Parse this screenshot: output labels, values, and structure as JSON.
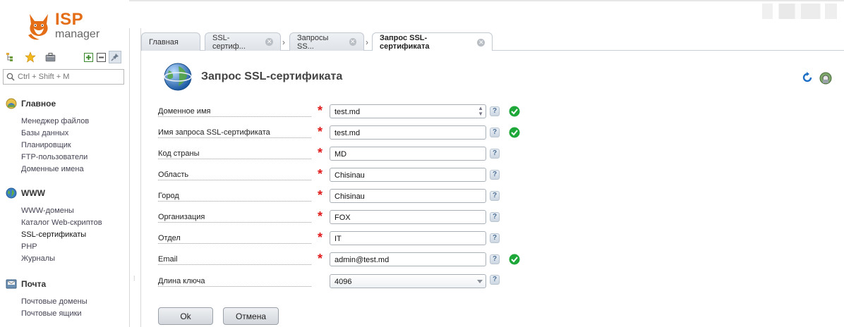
{
  "app": {
    "logo_top": "ISP",
    "logo_bottom": "manager"
  },
  "search": {
    "placeholder": "Ctrl + Shift + M"
  },
  "sidebar": {
    "groups": [
      {
        "title": "Главное",
        "icon": "home-icon",
        "items": [
          "Менеджер файлов",
          "Базы данных",
          "Планировщик",
          "FTP-пользователи",
          "Доменные имена"
        ]
      },
      {
        "title": "WWW",
        "icon": "globe-icon",
        "items": [
          "WWW-домены",
          "Каталог Web-скриптов",
          "SSL-сертификаты",
          "PHP",
          "Журналы"
        ]
      },
      {
        "title": "Почта",
        "icon": "mail-icon",
        "items": [
          "Почтовые домены",
          "Почтовые ящики"
        ]
      }
    ]
  },
  "tabs": [
    {
      "label": "Главная"
    },
    {
      "label": "SSL-сертиф..."
    },
    {
      "label": "Запросы SS..."
    },
    {
      "label": "Запрос SSL-сертификата"
    }
  ],
  "page": {
    "title": "Запрос SSL-сертификата"
  },
  "form": {
    "fields": [
      {
        "label": "Доменное имя",
        "value": "test.md",
        "valid": true
      },
      {
        "label": "Имя запроса SSL-сертификата",
        "value": "test.md",
        "valid": true
      },
      {
        "label": "Код страны",
        "value": "MD",
        "valid": false
      },
      {
        "label": "Область",
        "value": "Chisinau",
        "valid": false
      },
      {
        "label": "Город",
        "value": "Chisinau",
        "valid": false
      },
      {
        "label": "Организация",
        "value": "FOX",
        "valid": false
      },
      {
        "label": "Отдел",
        "value": "IT",
        "valid": false
      },
      {
        "label": "Email",
        "value": "admin@test.md",
        "valid": true
      }
    ],
    "key_length": {
      "label": "Длина ключа",
      "value": "4096"
    },
    "required_mark": "*",
    "help_mark": "?",
    "ok_label": "Ok",
    "cancel_label": "Отмена"
  },
  "colors": {
    "accent_orange": "#e46d17",
    "required_red": "#e01919",
    "valid_green": "#1fa83a"
  }
}
